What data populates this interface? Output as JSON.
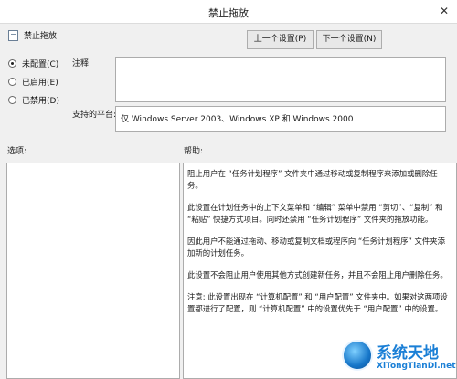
{
  "window": {
    "title": "禁止拖放"
  },
  "policy": {
    "name": "禁止拖放"
  },
  "nav": {
    "prev_label": "上一个设置(P)",
    "next_label": "下一个设置(N)"
  },
  "state": {
    "options": [
      {
        "label": "未配置(C)",
        "selected": true
      },
      {
        "label": "已启用(E)",
        "selected": false
      },
      {
        "label": "已禁用(D)",
        "selected": false
      }
    ]
  },
  "comment": {
    "label": "注释:",
    "value": ""
  },
  "platform": {
    "label": "支持的平台:",
    "value": "仅 Windows Server 2003、Windows XP 和 Windows 2000"
  },
  "options_panel": {
    "label": "选项:"
  },
  "help": {
    "label": "帮助:",
    "paragraphs": [
      "阻止用户在 “任务计划程序” 文件夹中通过移动或复制程序来添加或删除任务。",
      "此设置在计划任务中的上下文菜单和 “编辑” 菜单中禁用 “剪切”、“复制” 和 “粘贴” 快捷方式项目。同时还禁用 “任务计划程序” 文件夹的拖放功能。",
      "因此用户不能通过拖动、移动或复制文档或程序向 “任务计划程序” 文件夹添加新的计划任务。",
      "此设置不会阻止用户使用其他方式创建新任务，并且不会阻止用户删除任务。",
      "注意: 此设置出现在 “计算机配置” 和 “用户配置” 文件夹中。如果对这两项设置都进行了配置，则 “计算机配置” 中的设置优先于 “用户配置” 中的设置。"
    ]
  },
  "watermark": {
    "title": "系统天地",
    "subtitle": "XiTongTianDi.net"
  }
}
